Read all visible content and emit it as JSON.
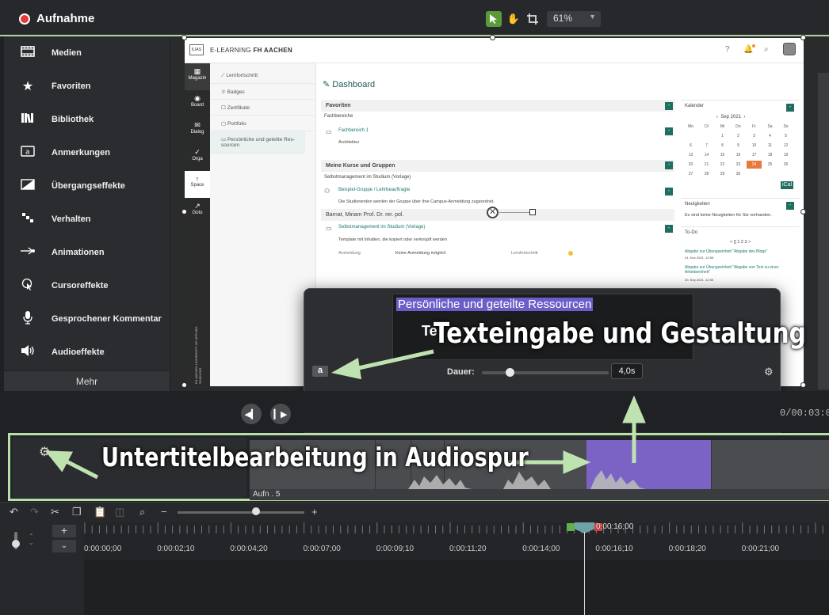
{
  "topbar": {
    "record_label": "Aufnahme",
    "zoom": "61%"
  },
  "sidebar": {
    "items": [
      {
        "label": "Medien",
        "icon": "film-icon"
      },
      {
        "label": "Favoriten",
        "icon": "star-icon"
      },
      {
        "label": "Bibliothek",
        "icon": "library-icon"
      },
      {
        "label": "Anmerkungen",
        "icon": "annotation-icon"
      },
      {
        "label": "Übergangseffekte",
        "icon": "transition-icon"
      },
      {
        "label": "Verhalten",
        "icon": "behavior-icon"
      },
      {
        "label": "Animationen",
        "icon": "animation-icon"
      },
      {
        "label": "Cursoreffekte",
        "icon": "cursor-icon"
      },
      {
        "label": "Gesprochener Kommentar",
        "icon": "microphone-icon"
      },
      {
        "label": "Audioeffekte",
        "icon": "speaker-icon"
      }
    ],
    "more": "Mehr"
  },
  "web": {
    "brand_prefix": "E-LEARNING",
    "brand_bold": "FH AACHEN",
    "logo_text": "ILIAS",
    "nav": [
      "Magazin",
      "Board",
      "Dialog",
      "Orga",
      "Space",
      "Goto"
    ],
    "sub": [
      "Lernfortschritt",
      "Badges",
      "Zertifikate",
      "Portfolio",
      "Persönliche und geteilte Res-sourcen"
    ],
    "page_title": "Dashboard",
    "favoriten": "Favoriten",
    "fachbereiche": "Fachbereiche",
    "fachbereich1": "Fachbereich 1",
    "architektur": "Architektur",
    "kurse": "Meine Kurse und Gruppen",
    "selbst": "Selbstmanagement im Studium (Vorlage)",
    "beispiel": "Beispiel-Gruppe / Lehrbeauftragte",
    "beispiel_desc": "Die Studierenden werden der Gruppe über ihre Campus-Anmeldung zugeordnet.",
    "barnat": "Barnat, Miriam Prof. Dr. rer. pol.",
    "selbst2": "Selbstmanagement im Studium (Vorlage)",
    "template_desc": "Template mit Inhalten, die kopiert oder verknüpft werden",
    "anmeldung": "Anmeldung",
    "keine": "Keine Anmeldung möglich",
    "lernfortschritt": "Lernfortschritt",
    "kalender": "Kalender",
    "month": "Sep 2021",
    "weekdays": [
      "Mo",
      "Di",
      "Mi",
      "Do",
      "Fr",
      "Sa",
      "So"
    ],
    "days": [
      "",
      "",
      "1",
      "2",
      "3",
      "4",
      "5",
      "6",
      "7",
      "8",
      "9",
      "10",
      "11",
      "12",
      "13",
      "14",
      "15",
      "16",
      "17",
      "18",
      "19",
      "20",
      "21",
      "22",
      "23",
      "24",
      "25",
      "26",
      "27",
      "28",
      "29",
      "30",
      "",
      "",
      ""
    ],
    "kal_btn": "iCal",
    "neuigkeiten": "Neuigkeiten",
    "neu_desc": "Es sind keine Neuigkeiten für Sie vorhanden.",
    "todo": "To-Do",
    "todo_pager": "< [] 1 2 3 >",
    "todo1": "Abgabe zur Übungseinheit \"Abgabe des Blogs\"",
    "todo1_date": "24. Dez 2021, 12:55",
    "todo2": "Abgabe zur Übungseinheit \"Abgabe von Text zu einer Arbeitseinheit\"",
    "todo2_date": "30. Sep 2021, 12:55",
    "vert_label": "FH AACHEN UNIVERSITY OF APPLIED SCIENCES"
  },
  "popup": {
    "selected_text": "Persönliche und geteilte Ressourcen",
    "partial": "Te",
    "a_label": "a",
    "dauer_label": "Dauer:",
    "dauer_value": "4,0s",
    "dauer_fraction": 0.22
  },
  "annotations": {
    "text1": "Texteingabe und Gestaltung",
    "text2": "Untertitelbearbeitung in Audiospur"
  },
  "player": {
    "timecode": "0/00:03:0"
  },
  "track": {
    "clip_label": "Aufn . 5"
  },
  "timeline": {
    "playhead": "0:00:16;00",
    "ticks": [
      "0:00:00;00",
      "0:00:02;10",
      "0:00:04;20",
      "0:00:07;00",
      "0:00:09;10",
      "0:00:11;20",
      "0:00:14;00",
      "0:00:16;10",
      "0:00:18;20",
      "0:00:21;00"
    ]
  }
}
